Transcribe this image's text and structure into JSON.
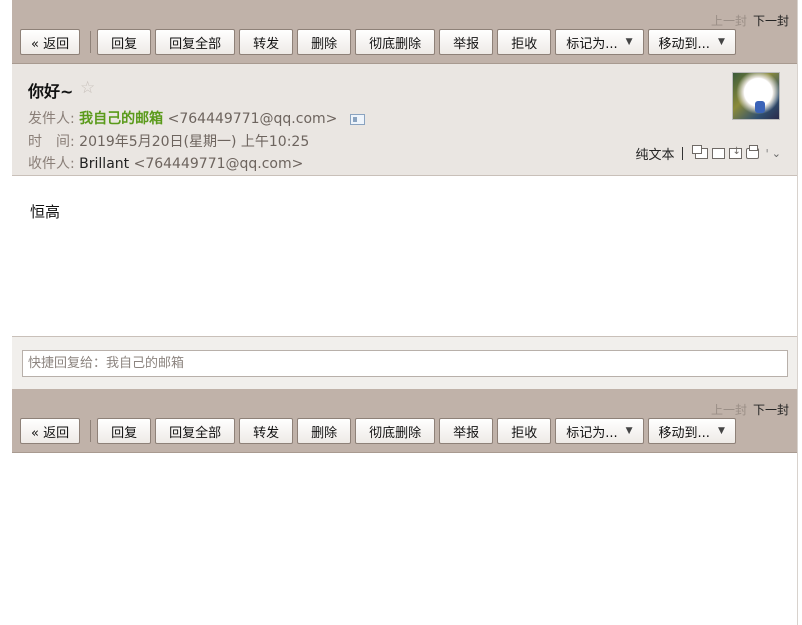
{
  "pager": {
    "prev": "上一封",
    "next": "下一封"
  },
  "toolbar": {
    "back": "« 返回",
    "reply": "回复",
    "reply_all": "回复全部",
    "forward": "转发",
    "delete": "删除",
    "delete_forever": "彻底删除",
    "report": "举报",
    "reject": "拒收",
    "mark_as": "标记为...",
    "move_to": "移动到..."
  },
  "message": {
    "subject": "你好~",
    "star_icon": "star-icon",
    "sender_label": "发件人:",
    "sender_name": "我自己的邮箱",
    "sender_address": "<764449771@qq.com>",
    "time_label": "时　间:",
    "time_value": "2019年5月20日(星期一) 上午10:25",
    "recipient_label": "收件人:",
    "recipient_name": "Brillant",
    "recipient_address": "<764449771@qq.com>",
    "plain_text": "纯文本",
    "body": "恒高"
  },
  "quick_reply": {
    "placeholder": "快捷回复给：我自己的邮箱"
  },
  "colors": {
    "toolbar_bg": "#c0b2a9",
    "header_bg": "#eae6e2",
    "sender_green": "#5a9a1a"
  }
}
